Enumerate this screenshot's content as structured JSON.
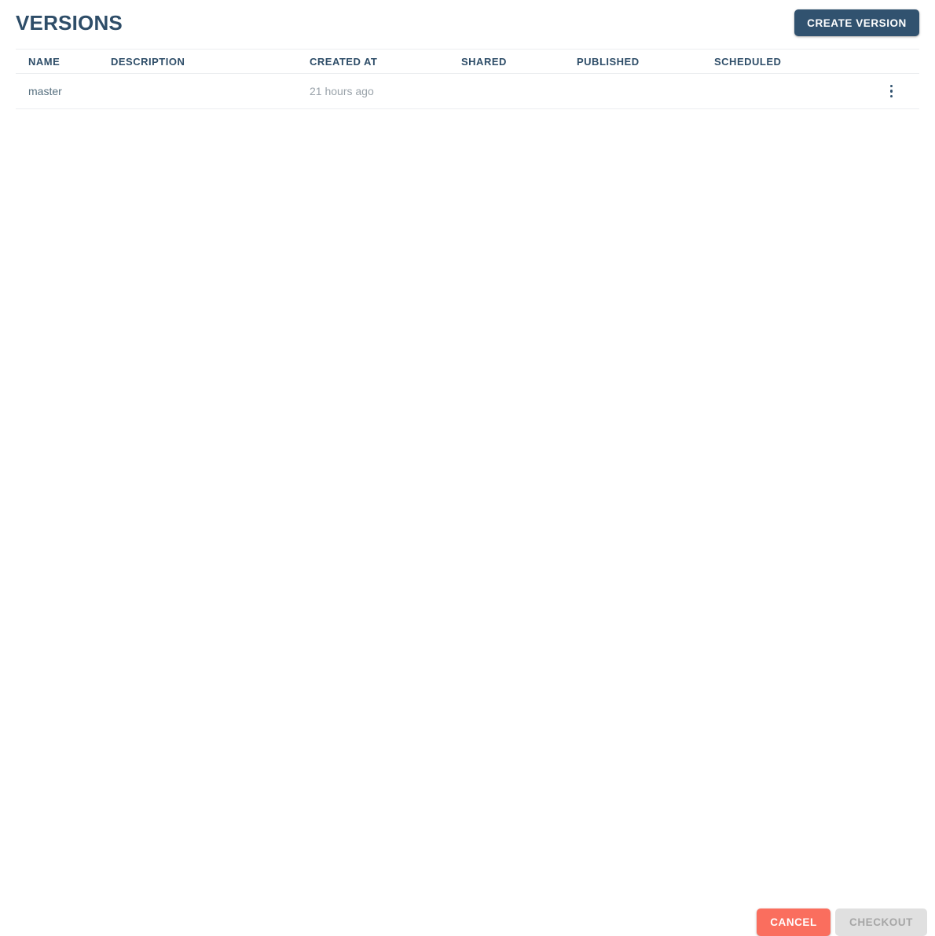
{
  "header": {
    "title": "VERSIONS",
    "create_button_label": "CREATE VERSION"
  },
  "table": {
    "columns": [
      {
        "key": "name",
        "label": "NAME"
      },
      {
        "key": "description",
        "label": "DESCRIPTION"
      },
      {
        "key": "created_at",
        "label": "CREATED AT"
      },
      {
        "key": "shared",
        "label": "SHARED"
      },
      {
        "key": "published",
        "label": "PUBLISHED"
      },
      {
        "key": "scheduled",
        "label": "SCHEDULED"
      }
    ],
    "rows": [
      {
        "name": "master",
        "description": "",
        "created_at": "21 hours ago",
        "shared": "",
        "published": "",
        "scheduled": "",
        "menu_icon": "more-vertical-icon"
      }
    ]
  },
  "footer": {
    "cancel_label": "CANCEL",
    "checkout_label": "CHECKOUT",
    "checkout_disabled": true
  },
  "colors": {
    "accent_dark": "#31526f",
    "title": "#2e4d68",
    "cancel": "#fa6e5e",
    "disabled_bg": "#e0e0e0",
    "disabled_text": "#a6a6a6",
    "border": "#eceef0",
    "row_text": "#57707f",
    "muted_text": "#9aa3aa",
    "background": "#ffffff"
  }
}
